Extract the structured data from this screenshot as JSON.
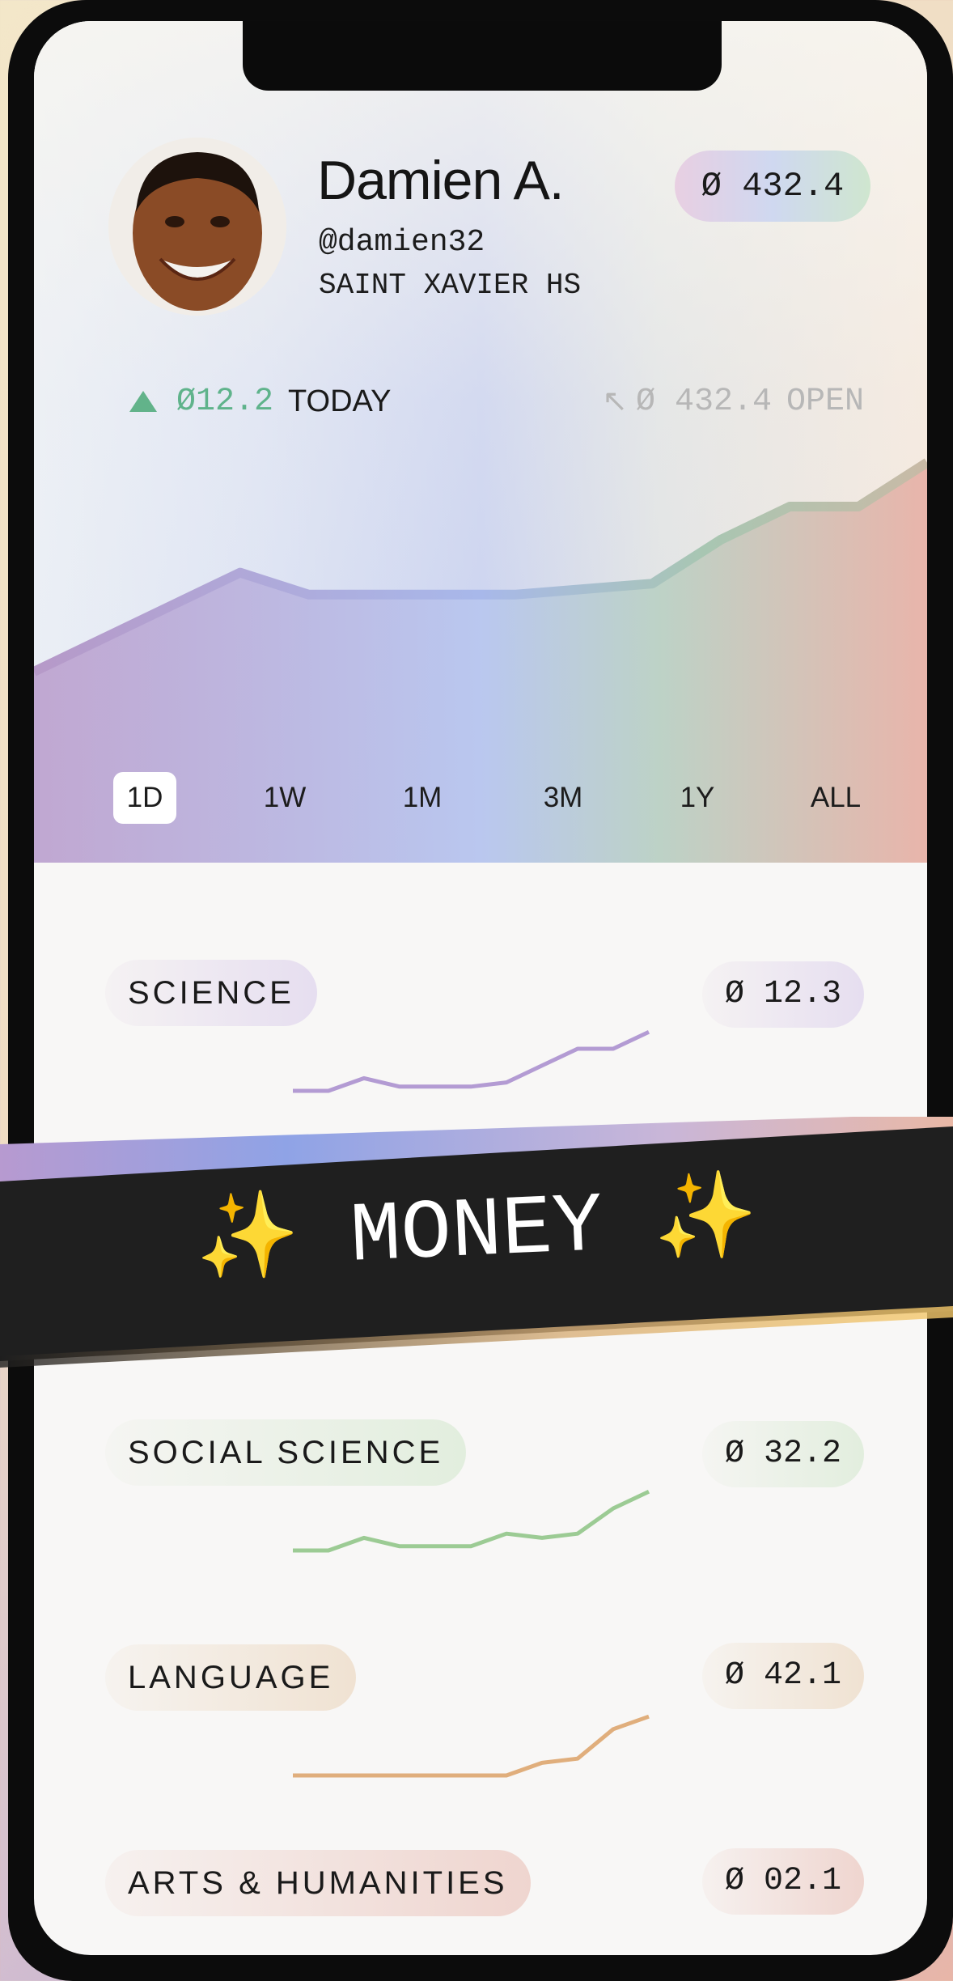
{
  "profile": {
    "name": "Damien A.",
    "handle": "@damien32",
    "school": "SAINT XAVIER HS",
    "balance": "Ø 432.4"
  },
  "stats": {
    "today_gain": "Ø12.2",
    "today_label": "TODAY",
    "open_icon": "arrow-up-left-icon",
    "open_value": "Ø 432.4",
    "open_label": "OPEN"
  },
  "chart_data": {
    "type": "area",
    "x": [
      0,
      1,
      2,
      3,
      4,
      5,
      6,
      7,
      8,
      9,
      10,
      11,
      12,
      13
    ],
    "series": [
      {
        "values": [
          20,
          26,
          32,
          38,
          34,
          34,
          34,
          34,
          35,
          36,
          44,
          50,
          50,
          58
        ]
      }
    ],
    "ylim": [
      0,
      70
    ]
  },
  "ranges": {
    "items": [
      "1D",
      "1W",
      "1M",
      "3M",
      "1Y",
      "ALL"
    ],
    "active": "1D"
  },
  "subjects": [
    {
      "label": "SCIENCE",
      "value": "Ø 12.3",
      "color": "#b39bd3",
      "spark": [
        0,
        0,
        6,
        2,
        2,
        2,
        4,
        12,
        20,
        20,
        28
      ]
    },
    {
      "label": "SOCIAL SCIENCE",
      "value": "Ø 32.2",
      "color": "#9ccb94",
      "spark": [
        0,
        0,
        6,
        2,
        2,
        2,
        8,
        6,
        8,
        20,
        28
      ]
    },
    {
      "label": "LANGUAGE",
      "value": "Ø 42.1",
      "color": "#e0ae7c",
      "spark": [
        0,
        0,
        0,
        0,
        0,
        0,
        0,
        6,
        8,
        22,
        28
      ]
    },
    {
      "label": "ARTS & HUMANITIES",
      "value": "Ø 02.1",
      "color": "#e6b3ad",
      "spark": []
    }
  ],
  "banner": {
    "text": "MONEY",
    "sparkle": "✨"
  }
}
